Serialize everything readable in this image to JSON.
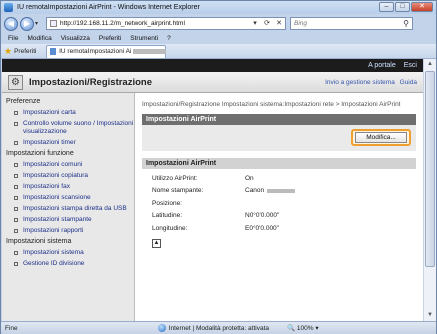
{
  "window": {
    "title": "IU remotaImpostazioni AirPrint - Windows Internet Explorer",
    "controls": [
      "–",
      "□",
      "✕"
    ]
  },
  "address": {
    "url": "http://192.168.11.2/m_network_airprint.html",
    "search_placeholder": "Bing"
  },
  "menubar": [
    "File",
    "Modifica",
    "Visualizza",
    "Preferiti",
    "Strumenti",
    "?"
  ],
  "favorites": {
    "label": "Preferiti",
    "tab_title": "IU remotaImpostazioni AirPrint:"
  },
  "topbar": {
    "portal_link": "A portale",
    "logout_link": "Esci"
  },
  "header": {
    "title": "Impostazioni/Registrazione",
    "links": [
      "Invio a gestione sistema",
      "Guida"
    ]
  },
  "sidebar": {
    "sections": [
      {
        "title": "Preferenze",
        "items": [
          "Impostazioni carta",
          "Controllo volume suono / Impostazioni visualizzazione",
          "Impostazioni timer"
        ]
      },
      {
        "title": "Impostazioni funzione",
        "items": [
          "Impostazioni comuni",
          "Impostazioni copiatura",
          "Impostazioni fax",
          "Impostazioni scansione",
          "Impostazioni stampa diretta da USB",
          "Impostazioni stampante",
          "Impostazioni rapporti"
        ]
      },
      {
        "title": "Impostazioni sistema",
        "items": [
          "Impostazioni sistema",
          "Gestione ID divisione"
        ]
      }
    ]
  },
  "main": {
    "breadcrumb": "Impostazioni/Registrazione Impostazioni sistema:Impostazioni rete > Impostazioni AirPrint",
    "panel_title": "Impostazioni AirPrint",
    "edit_button": "Modifica...",
    "info_title": "Impostazioni AirPrint",
    "rows": [
      {
        "key": "Utilizzo AirPrint:",
        "value": "On"
      },
      {
        "key": "Nome stampante:",
        "value": "Canon"
      },
      {
        "key": "Posizione:",
        "value": ""
      },
      {
        "key": "Latitudine:",
        "value": "N0°0'0.000\""
      },
      {
        "key": "Longitudine:",
        "value": "E0°0'0.000\""
      }
    ]
  },
  "status": {
    "left": "Fine",
    "zone": "Internet | Modalità protetta: attivata",
    "zoom": "100%"
  }
}
